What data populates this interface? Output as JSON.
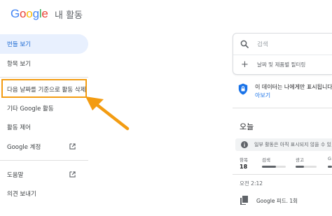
{
  "header": {
    "logo": [
      "G",
      "o",
      "o",
      "g",
      "l",
      "e"
    ],
    "title": "내 활동"
  },
  "sidebar": {
    "items": [
      {
        "label": "번들 보기",
        "active": true
      },
      {
        "label": "항목 보기"
      },
      {
        "label": "다음 날짜를 기준으로 활동 삭제"
      },
      {
        "label": "기타 Google 활동"
      },
      {
        "label": "활동 제어"
      },
      {
        "label": "Google 계정",
        "icon": "open-in-new-icon"
      },
      {
        "label": "도움말",
        "icon": "open-in-new-icon"
      },
      {
        "label": "의견 보내기"
      }
    ]
  },
  "search": {
    "placeholder": "검색",
    "filter_label": "날짜 및 제품별 필터링"
  },
  "privacy": {
    "text": "이 데이터는 나에게만 표시됩니다.",
    "link": "아보기"
  },
  "today": {
    "title": "오늘",
    "info": "일부 활동은 아직 표시되지 않을 수 있",
    "stats": [
      {
        "label": "항목",
        "value": "18"
      },
      {
        "label": "검색"
      },
      {
        "label": "광고"
      },
      {
        "label": "G"
      }
    ],
    "time": "오전 2:12",
    "feed_item": "Google 피드. 1회"
  },
  "colors": {
    "accent": "#1a73e8",
    "active_bg": "#e8f0fe",
    "highlight": "#f39c12"
  }
}
